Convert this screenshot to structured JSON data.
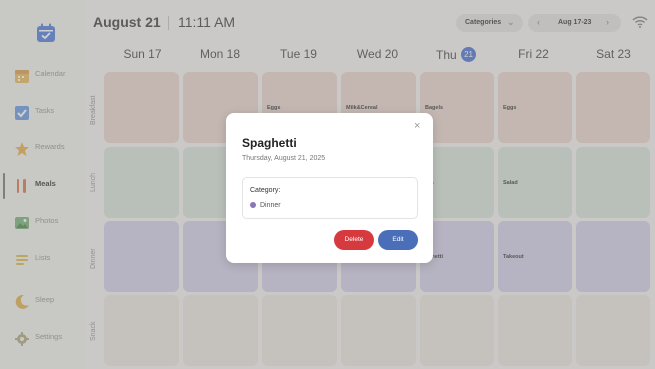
{
  "header": {
    "date": "August 21",
    "time": "11:11 AM",
    "categories_label": "Categories",
    "week_range": "Aug 17-23",
    "prev_symbol": "‹",
    "next_symbol": "›",
    "dropdown_symbol": "⌄"
  },
  "sidebar": {
    "items": [
      {
        "label": "Calendar",
        "icon": "calendar-icon"
      },
      {
        "label": "Tasks",
        "icon": "checkbox-icon"
      },
      {
        "label": "Rewards",
        "icon": "star-icon"
      },
      {
        "label": "Meals",
        "icon": "fork-knife-icon",
        "active": true
      },
      {
        "label": "Photos",
        "icon": "photo-icon"
      },
      {
        "label": "Lists",
        "icon": "list-icon"
      },
      {
        "label": "Sleep",
        "icon": "moon-icon"
      },
      {
        "label": "Settings",
        "icon": "gear-icon"
      }
    ]
  },
  "days": [
    {
      "label": "Sun 17"
    },
    {
      "label": "Mon 18"
    },
    {
      "label": "Tue 19"
    },
    {
      "label": "Wed 20"
    },
    {
      "label": "Thu",
      "badge": "21"
    },
    {
      "label": "Fri 22"
    },
    {
      "label": "Sat 23"
    }
  ],
  "meal_rows": [
    "Breakfast",
    "Lunch",
    "Dinner",
    "Snack"
  ],
  "meals": {
    "breakfast": [
      "",
      "",
      "Eggs",
      "Milk&Cereal",
      "Bagels",
      "Eggs",
      ""
    ],
    "lunch": [
      "",
      "",
      "",
      "",
      "zza",
      "Salad",
      ""
    ],
    "dinner": [
      "",
      "",
      "",
      "",
      "aghetti",
      "Takeout",
      ""
    ],
    "snack": [
      "",
      "",
      "",
      "",
      "",
      "",
      ""
    ]
  },
  "colors": {
    "breakfast": "#e9d2c6",
    "lunch": "#d6e2d6",
    "dinner": "#cfcbe6",
    "snack": "#ebe6dd",
    "accent": "#3a64c8",
    "delete": "#d63a3f",
    "edit": "#4a6fb8",
    "category_dot": "#8878b5"
  },
  "modal": {
    "title": "Spaghetti",
    "date": "Thursday, August 21, 2025",
    "category_label": "Category:",
    "category_value": "Dinner",
    "delete_label": "Delete",
    "edit_label": "Edit",
    "close_symbol": "×"
  }
}
